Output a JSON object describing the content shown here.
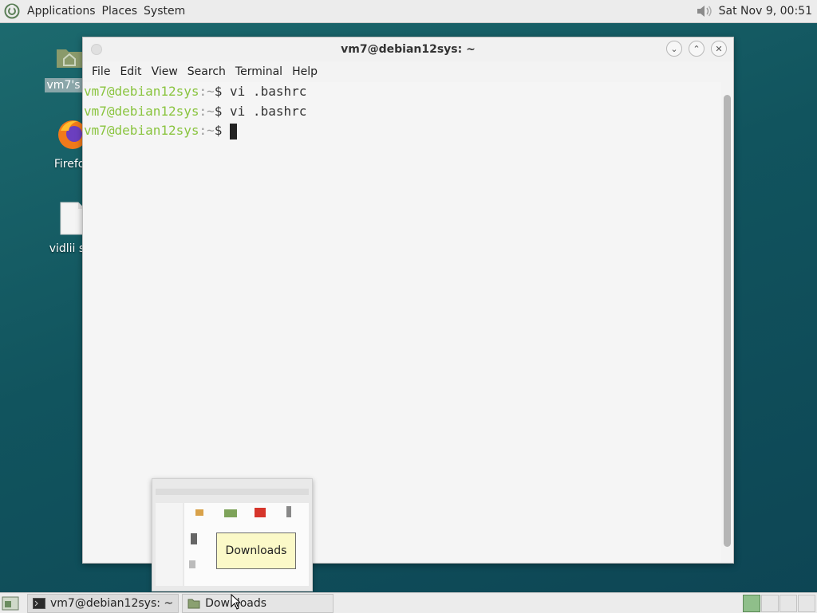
{
  "top_panel": {
    "menus": [
      "Applications",
      "Places",
      "System"
    ],
    "clock": "Sat Nov 9, 00:51"
  },
  "desktop": {
    "icons": [
      {
        "label": "vm7's H"
      },
      {
        "label": "Firefox"
      },
      {
        "label": "vidlii sta"
      }
    ]
  },
  "terminal": {
    "title": "vm7@debian12sys: ~",
    "menu": [
      "File",
      "Edit",
      "View",
      "Search",
      "Terminal",
      "Help"
    ],
    "lines": [
      {
        "user": "vm7@debian12sys",
        "path": ":~",
        "sym": "$ ",
        "cmd": "vi .bashrc"
      },
      {
        "user": "vm7@debian12sys",
        "path": ":~",
        "sym": "$ ",
        "cmd": "vi .bashrc"
      },
      {
        "user": "vm7@debian12sys",
        "path": ":~",
        "sym": "$ ",
        "cmd": ""
      }
    ]
  },
  "tooltip": "Downloads",
  "taskbar": {
    "tasks": [
      {
        "label": "vm7@debian12sys: ~"
      },
      {
        "label": "Downloads"
      }
    ]
  },
  "colors": {
    "prompt_user": "#8ac43f",
    "desktop_bg": "#11545e",
    "active_workspace": "#8fbf8a"
  }
}
